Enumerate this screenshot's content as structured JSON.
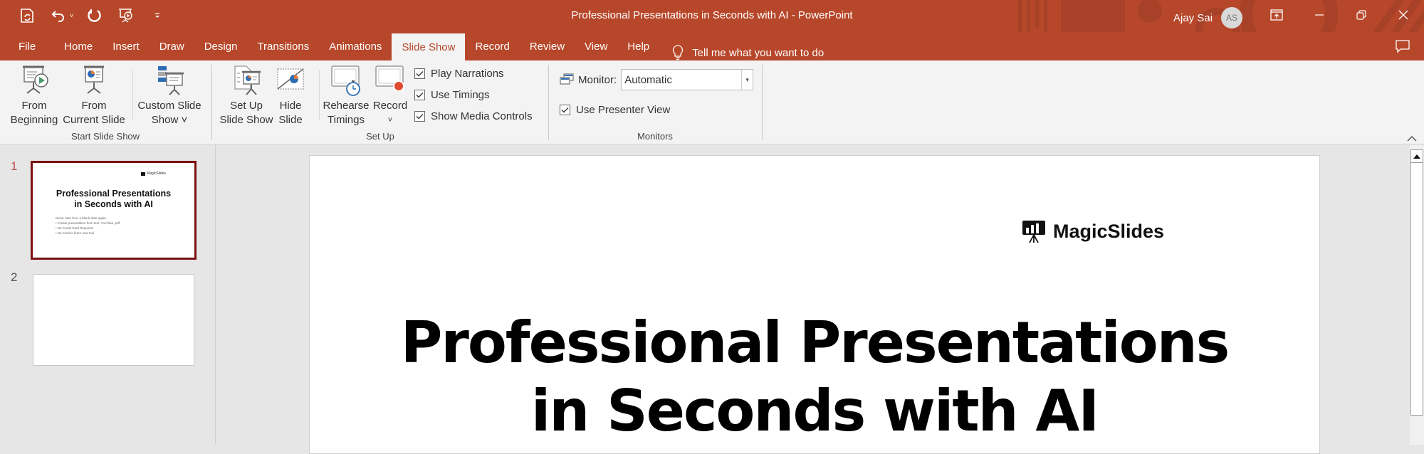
{
  "window": {
    "title": "Professional Presentations in Seconds with AI  -  PowerPoint",
    "user_name": "Ajay Sai",
    "user_initials": "AS",
    "accent_color": "#b7472a"
  },
  "qat": {
    "icons": [
      "autosave-icon",
      "undo-icon",
      "redo-icon",
      "start-from-beginning-icon",
      "customize-qat-icon"
    ]
  },
  "tabs": [
    {
      "label": "File"
    },
    {
      "label": "Home"
    },
    {
      "label": "Insert"
    },
    {
      "label": "Draw"
    },
    {
      "label": "Design"
    },
    {
      "label": "Transitions"
    },
    {
      "label": "Animations"
    },
    {
      "label": "Slide Show",
      "active": true
    },
    {
      "label": "Record"
    },
    {
      "label": "Review"
    },
    {
      "label": "View"
    },
    {
      "label": "Help"
    }
  ],
  "tellme": "Tell me what you want to do",
  "ribbon": {
    "start_slide_show": {
      "label": "Start Slide Show",
      "from_beginning": [
        "From",
        "Beginning"
      ],
      "from_current": [
        "From",
        "Current Slide"
      ],
      "custom": [
        "Custom Slide",
        "Show ˅"
      ]
    },
    "set_up": {
      "label": "Set Up",
      "set_up_show": [
        "Set Up",
        "Slide Show"
      ],
      "hide_slide": [
        "Hide",
        "Slide"
      ],
      "rehearse": [
        "Rehearse",
        "Timings"
      ],
      "record": [
        "Record",
        "˅"
      ],
      "checkboxes": [
        {
          "label": "Play Narrations",
          "checked": true
        },
        {
          "label": "Use Timings",
          "checked": true
        },
        {
          "label": "Show Media Controls",
          "checked": true
        }
      ]
    },
    "monitors": {
      "label": "Monitors",
      "monitor_label": "Monitor:",
      "monitor_value": "Automatic",
      "presenter_view": {
        "label": "Use Presenter View",
        "checked": true
      }
    }
  },
  "thumbnails": [
    {
      "number": "1",
      "selected": true,
      "logo": "MagicSlides",
      "title_line1": "Professional Presentations",
      "title_line2": "in Seconds with AI",
      "body": [
        "Never start from a blank slide again.",
        "• Create presentation from text, YouTube, pdf",
        "• No Credit Card Required",
        "• No need to learn new tool"
      ]
    },
    {
      "number": "2",
      "selected": false
    }
  ],
  "slide": {
    "logo_text": "MagicSlides",
    "title_line1": "Professional Presentations",
    "title_line2": "in Seconds with AI"
  }
}
